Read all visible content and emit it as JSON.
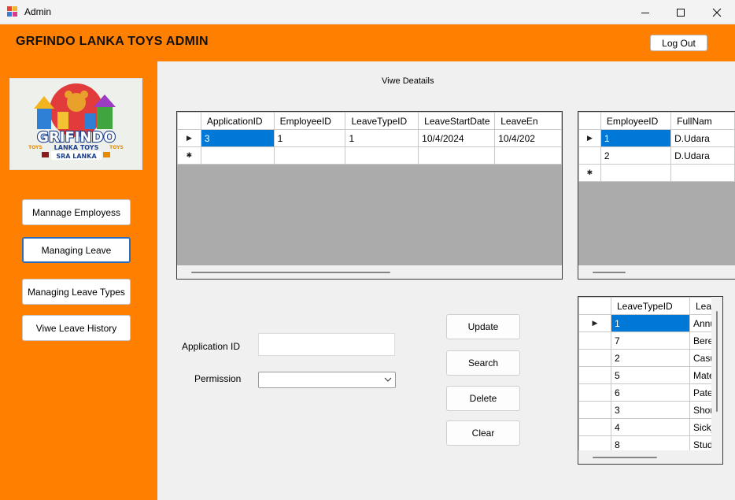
{
  "window": {
    "title": "Admin"
  },
  "header": {
    "title": "GRFINDO LANKA TOYS ADMIN",
    "logout_label": "Log Out"
  },
  "logo": {
    "line1": "GRIFINDO",
    "line2": "LANKA TOYS",
    "line3": "SRA LANKA",
    "toys_left": "TOYS",
    "toys_right": "TOYS"
  },
  "sidebar": {
    "items": [
      {
        "label": "Mannage Employess"
      },
      {
        "label": "Managing Leave"
      },
      {
        "label": "Managing Leave Types"
      },
      {
        "label": "Viwe Leave History"
      }
    ]
  },
  "main": {
    "view_label": "Viwe Deatails"
  },
  "applications_grid": {
    "columns": [
      "ApplicationID",
      "EmployeeID",
      "LeaveTypeID",
      "LeaveStartDate",
      "LeaveEn"
    ],
    "rows": [
      [
        "3",
        "1",
        "1",
        "10/4/2024",
        "10/4/202"
      ]
    ]
  },
  "employees_grid": {
    "columns": [
      "EmployeeID",
      "FullNam"
    ],
    "rows": [
      [
        "1",
        "D.Udara"
      ],
      [
        "2",
        "D.Udara"
      ]
    ]
  },
  "leavetypes_grid": {
    "columns": [
      "LeaveTypeID",
      "Lea"
    ],
    "rows": [
      [
        "1",
        "Annu"
      ],
      [
        "7",
        "Bere"
      ],
      [
        "2",
        "Casu"
      ],
      [
        "5",
        "Mate"
      ],
      [
        "6",
        "Pate"
      ],
      [
        "3",
        "Shor"
      ],
      [
        "4",
        "Sick_"
      ],
      [
        "8",
        "Stud"
      ]
    ]
  },
  "form": {
    "application_id_label": "Application ID",
    "application_id_value": "",
    "permission_label": "Permission",
    "permission_value": ""
  },
  "actions": {
    "update": "Update",
    "search": "Search",
    "delete": "Delete",
    "clear": "Clear"
  },
  "glyphs": {
    "row_current": "▶",
    "row_new": "✱"
  },
  "colors": {
    "accent": "#ff8000",
    "selection": "#0078d7",
    "grid_empty": "#ababab"
  }
}
